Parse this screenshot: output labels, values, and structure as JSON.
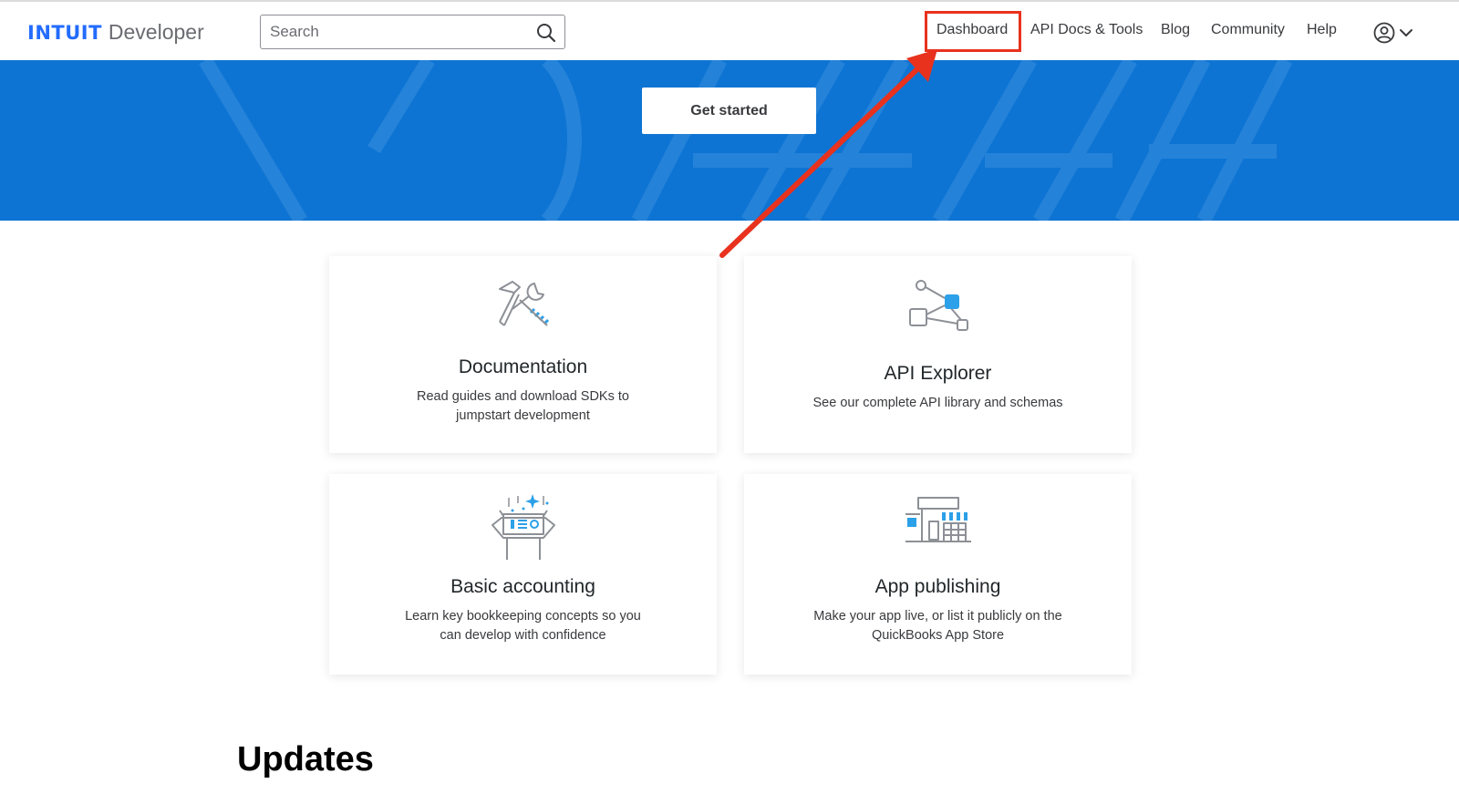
{
  "header": {
    "logo_brand": "INTUIT",
    "logo_sub": "Developer",
    "search_placeholder": "Search",
    "nav": {
      "dashboard": "Dashboard",
      "docs": "API Docs & Tools",
      "blog": "Blog",
      "community": "Community",
      "help": "Help"
    },
    "user_icon": "user-circle-icon",
    "chevron_icon": "chevron-down-icon"
  },
  "hero": {
    "cta_label": "Get started"
  },
  "cards": [
    {
      "icon": "tools-icon",
      "title": "Documentation",
      "desc": "Read guides and download SDKs to jumpstart development"
    },
    {
      "icon": "network-nodes-icon",
      "title": "API Explorer",
      "desc": "See our complete API library and schemas"
    },
    {
      "icon": "accounting-box-icon",
      "title": "Basic accounting",
      "desc": "Learn key bookkeeping concepts so you can develop with confidence"
    },
    {
      "icon": "storefront-icon",
      "title": "App publishing",
      "desc": "Make your app live, or list it publicly on the QuickBooks App Store"
    }
  ],
  "updates_heading": "Updates",
  "colors": {
    "brand_blue": "#236cff",
    "hero_blue": "#0d74d3",
    "annotation_red": "#e8321e",
    "icon_accent": "#2ca0e8"
  }
}
